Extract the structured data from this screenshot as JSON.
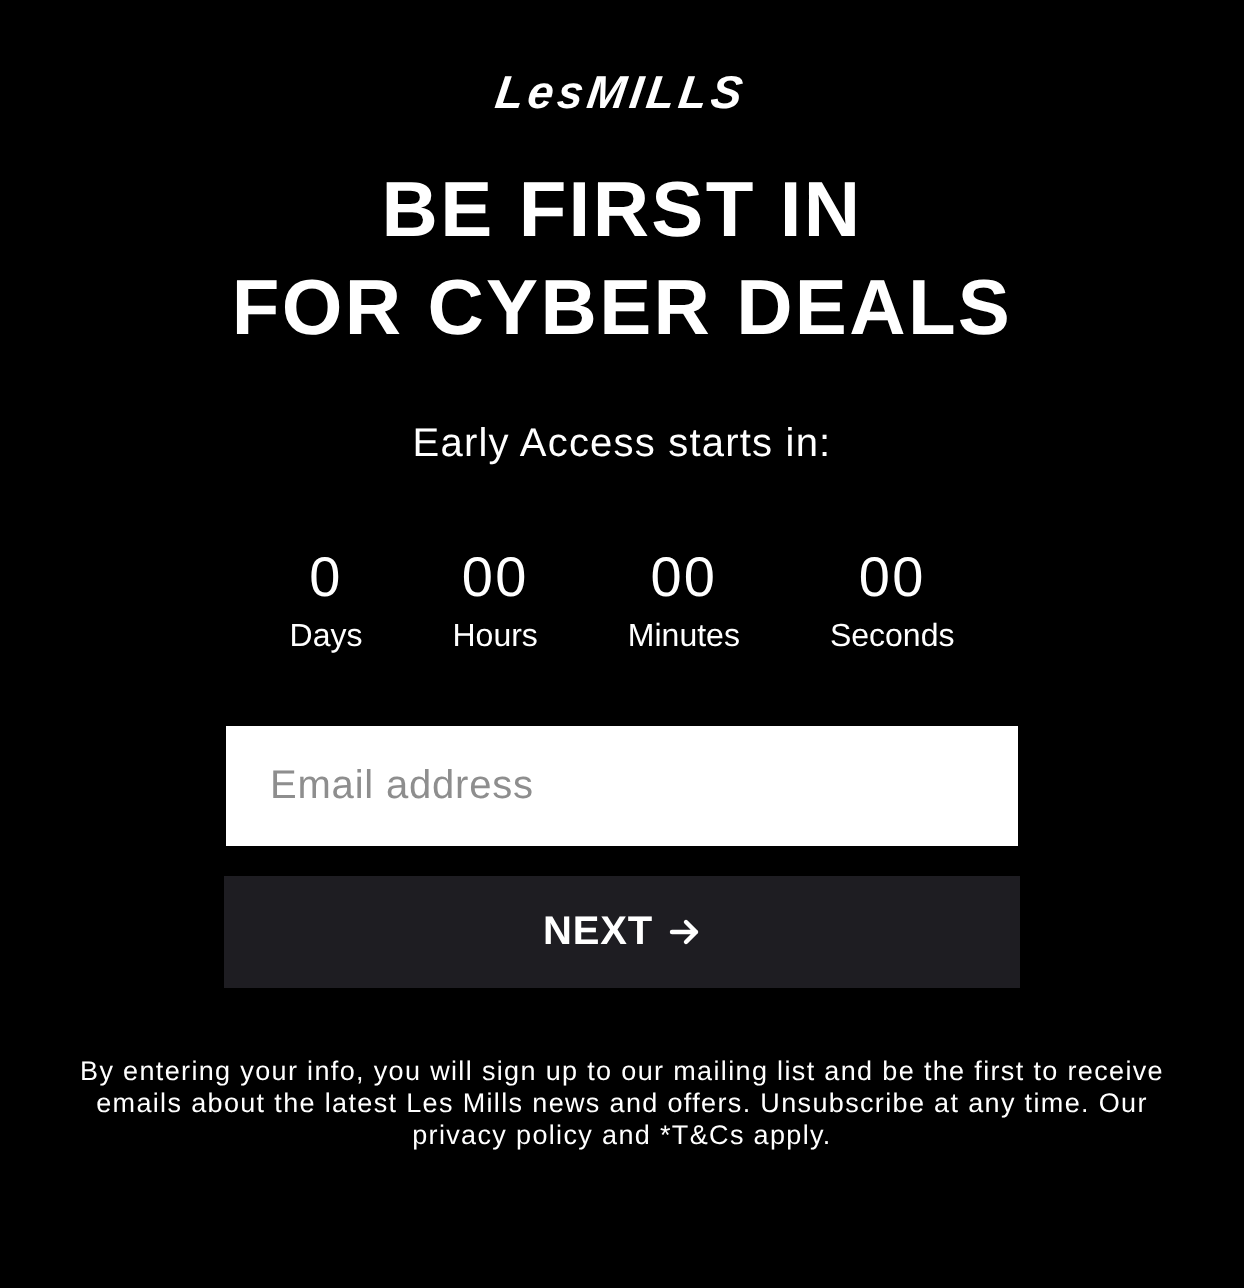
{
  "logo": {
    "text": "LesMILLS"
  },
  "heading": [
    "BE FIRST IN",
    "FOR CYBER DEALS"
  ],
  "subheading": "Early Access starts in:",
  "countdown": [
    {
      "value": "0",
      "unit": "Days"
    },
    {
      "value": "00",
      "unit": "Hours"
    },
    {
      "value": "00",
      "unit": "Minutes"
    },
    {
      "value": "00",
      "unit": "Seconds"
    }
  ],
  "email_field": {
    "placeholder": "Email address"
  },
  "next_button": {
    "label": "NEXT"
  },
  "disclaimer": "By entering your info, you will sign up to our mailing list and be the first to receive emails about the latest Les Mills news and offers. Unsubscribe at any time. Our privacy policy and *T&Cs apply."
}
